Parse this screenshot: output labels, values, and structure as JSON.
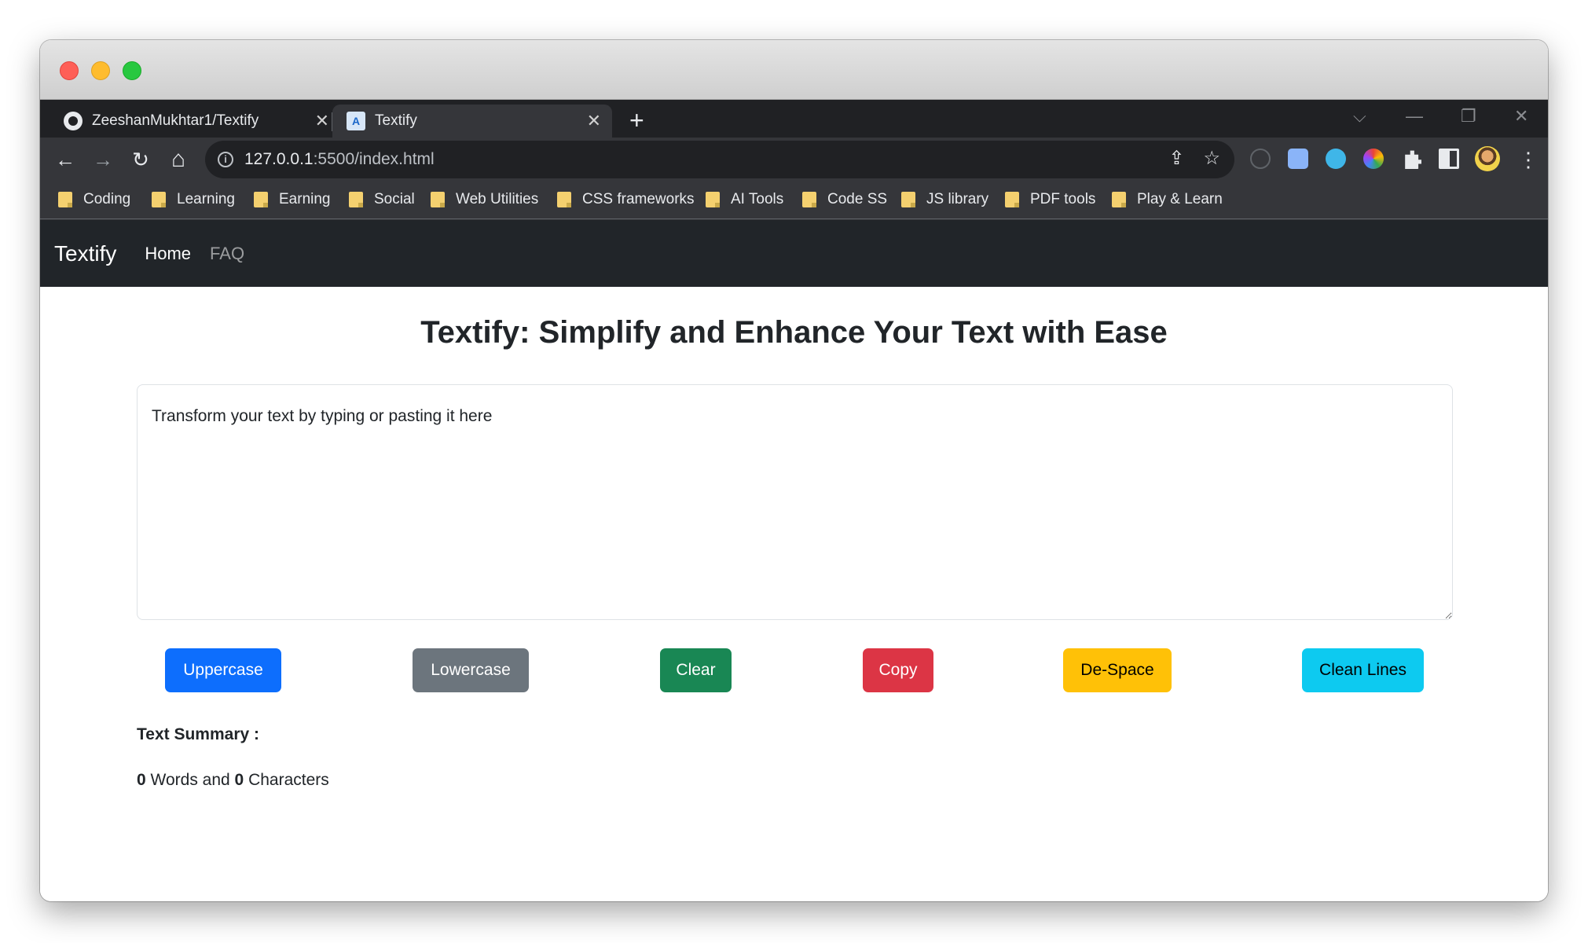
{
  "browser": {
    "tabs": [
      {
        "title": "ZeeshanMukhtar1/Textify",
        "close": "✕",
        "icon": "github-icon"
      },
      {
        "title": "Textify",
        "close": "✕",
        "icon": "textify-favicon"
      }
    ],
    "new_tab": "+",
    "window_controls": {
      "dropdown": "⌵",
      "minimize": "—",
      "restore": "❐",
      "close": "✕"
    },
    "nav": {
      "back": "←",
      "forward": "→",
      "reload": "↻",
      "home": "⌂"
    },
    "url_host": "127.0.0.1",
    "url_rest": ":5500/index.html",
    "omnibox_icons": {
      "share": "⇪",
      "star": "☆"
    },
    "bookmarks": [
      "Coding",
      "Learning",
      "Earning",
      "Social",
      "Web Utilities",
      "CSS frameworks",
      "AI Tools",
      "Code SS",
      "JS library",
      "PDF tools",
      "Play & Learn"
    ],
    "menu": "⋮"
  },
  "navbar": {
    "brand": "Textify",
    "links": [
      "Home",
      "FAQ"
    ]
  },
  "main": {
    "heading": "Textify: Simplify and Enhance Your Text with Ease",
    "textarea_placeholder": "Transform your text by typing or pasting it here",
    "buttons": {
      "uppercase": "Uppercase",
      "lowercase": "Lowercase",
      "clear": "Clear",
      "copy": "Copy",
      "despace": "De-Space",
      "clean_lines": "Clean Lines"
    },
    "summary_title": "Text Summary :",
    "word_count": "0",
    "words_label": "Words and",
    "char_count": "0",
    "chars_label": "Characters"
  },
  "colors": {
    "primary": "#0d6efd",
    "secondary": "#6c757d",
    "success": "#198754",
    "danger": "#dc3545",
    "warning": "#ffc107",
    "info": "#0dcaf0",
    "navbar": "#212529"
  }
}
